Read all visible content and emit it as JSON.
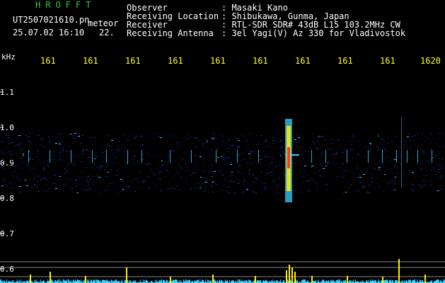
{
  "header": {
    "logo": "HROFFT",
    "filename": "UT2507021610.pn",
    "meteor_label": "meteor",
    "timestamp": "25.07.02 16:10",
    "frame_no": "22."
  },
  "station": {
    "rows": [
      {
        "label": "Observer",
        "value": ": Masaki Kano"
      },
      {
        "label": "Receiving Location",
        "value": ": Shibukawa, Gunma, Japan"
      },
      {
        "label": "Receiver",
        "value": ": RTL-SDR SDR# 43dB L15 103.2MHz CW"
      },
      {
        "label": "Receiving Antenna",
        "value": ": 3el Yagi(V) Az 330 for Vladivostok"
      }
    ]
  },
  "axes": {
    "khz_label": "kHz",
    "freq_ticks": [
      "161",
      "161",
      "161",
      "161",
      "161",
      "161",
      "161",
      "161",
      "161",
      "1620"
    ],
    "y_ticks": [
      "1.1",
      "1.0",
      "0.9",
      "0.8",
      "0.7",
      "0.6"
    ]
  },
  "colors": {
    "text_green": "#2ecc40",
    "text_white": "#ffffff",
    "text_yellow": "#ffff2a",
    "background": "#000000",
    "noise_blue": "#1a2a8a",
    "signal_cyan": "#39d0ff",
    "signal_yellow": "#fff000",
    "signal_red": "#ff3b1f"
  }
}
